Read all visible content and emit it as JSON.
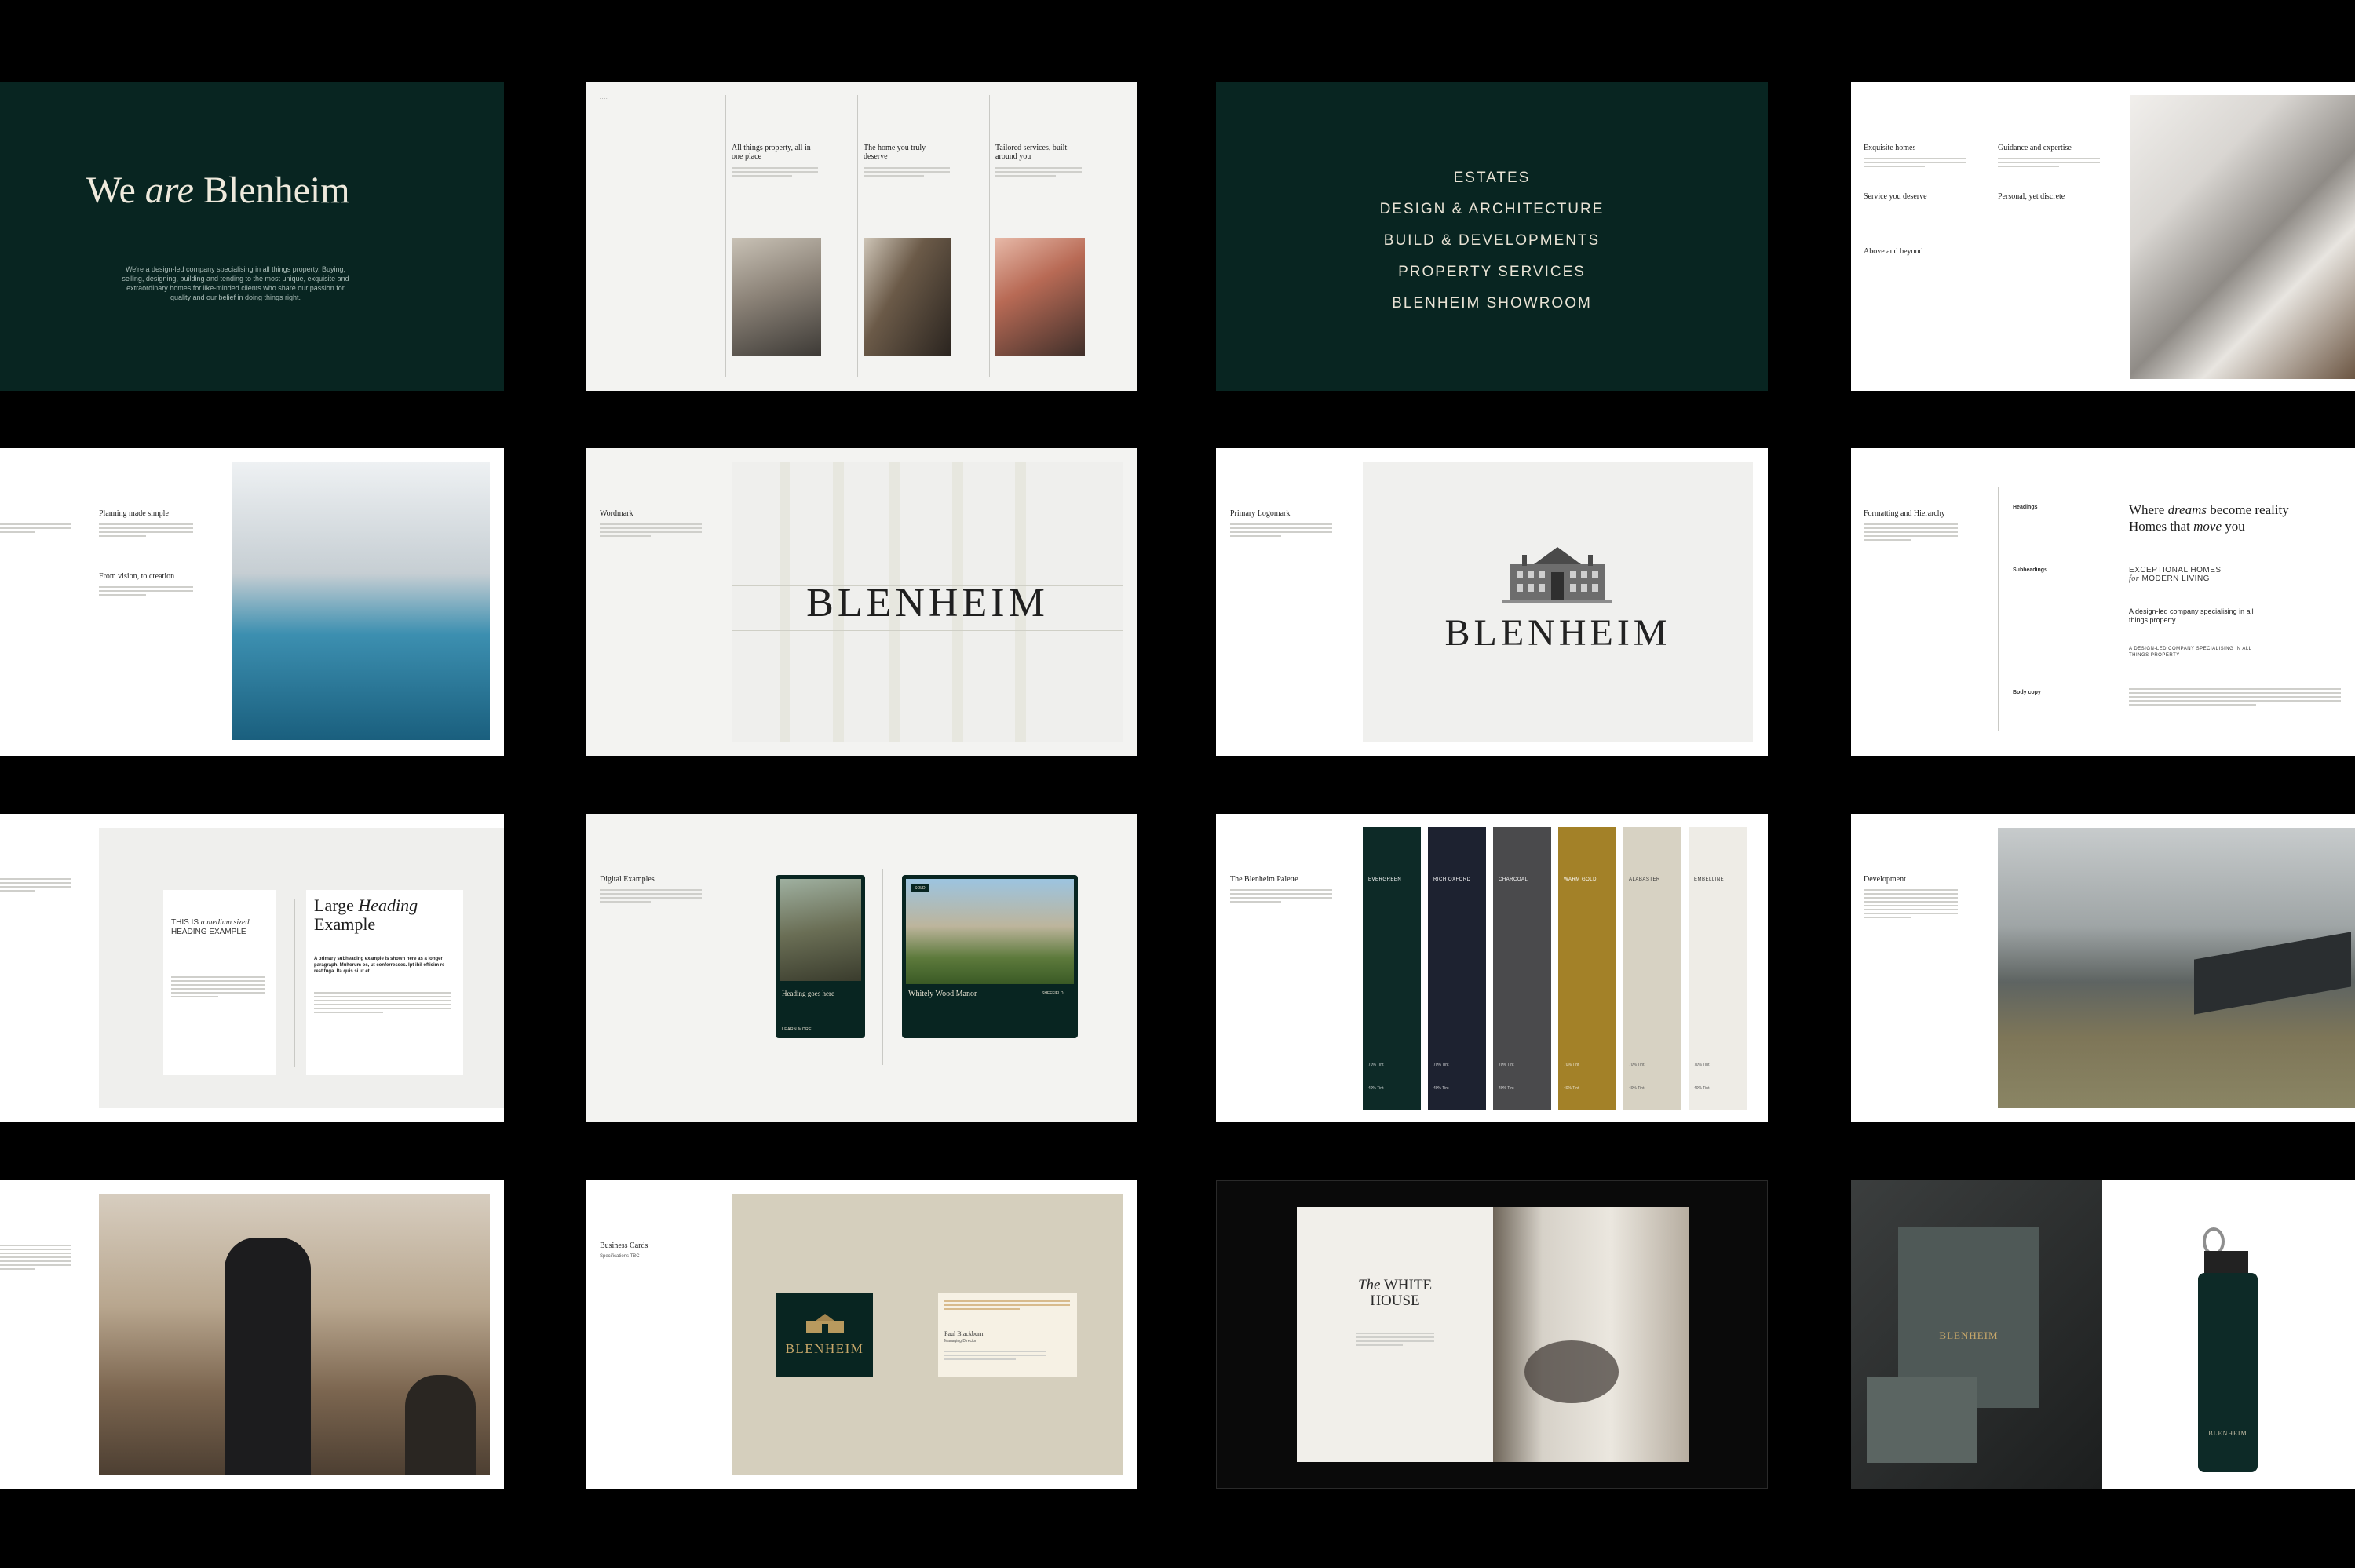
{
  "slide1": {
    "title_pre": "We ",
    "title_em": "are",
    "title_post": " Blenheim",
    "intro": "We're a design-led company specialising in all things property. Buying, selling, designing, building and tending to the most unique, exquisite and extraordinary homes for like-minded clients who share our passion for quality and our belief in doing things right."
  },
  "slide2": {
    "col1_heading": "All things property, all in one place",
    "col2_heading": "The home you truly deserve",
    "col3_heading": "Tailored services, built around you"
  },
  "slide3": {
    "services": [
      "ESTATES",
      "DESIGN & ARCHITECTURE",
      "BUILD & DEVELOPMENTS",
      "PROPERTY SERVICES",
      "BLENHEIM SHOWROOM"
    ]
  },
  "slide4": {
    "headings": [
      "Exquisite homes",
      "Service you deserve",
      "Above and beyond",
      "Guidance and expertise",
      "Personal, yet discrete"
    ]
  },
  "slide5": {
    "headings": [
      "Planning made simple",
      "From vision, to creation"
    ]
  },
  "slide6": {
    "label": "Wordmark",
    "wordmark": "BLENHEIM"
  },
  "slide7": {
    "label": "Primary Logomark",
    "wordmark": "BLENHEIM"
  },
  "slide8": {
    "label": "Formatting and Hierarchy",
    "spec_headings": "Headings",
    "spec_subheadings": "Subheadings",
    "spec_body": "Body copy",
    "ex_heading_1": "Where ",
    "ex_heading_em1": "dreams",
    "ex_heading_2": " become reality",
    "ex_heading_3": "Homes that ",
    "ex_heading_em2": "move",
    "ex_heading_4": " you",
    "ex_sub_1": "EXCEPTIONAL HOMES",
    "ex_sub_em": "for",
    "ex_sub_2": " MODERN LIVING",
    "ex_sub_3": "A design-led company specialising in all things property",
    "ex_sub_4": "A DESIGN-LED COMPANY SPECIALISING IN ALL THINGS PROPERTY"
  },
  "slide9": {
    "card1_line1": "THIS IS ",
    "card1_em": "a medium sized",
    "card1_line2": "HEADING EXAMPLE",
    "card2_line1": "Large ",
    "card2_em": "Heading",
    "card2_line2": "Example",
    "card2_sub": "A primary subheading example is shown here as a longer paragraph. Multorum os, ut conferresses. Ipt ihil officim re rest fuga. Ita quis si ut et."
  },
  "slide10": {
    "label": "Digital Examples",
    "phone_heading": "Heading goes here",
    "phone_btn": "LEARN MORE",
    "card_property": "Whitely Wood Manor",
    "card_tag": "SOLD",
    "card_location": "SHEFFIELD"
  },
  "slide11": {
    "label": "The Blenheim Palette",
    "swatches": [
      {
        "name": "EVERGREEN",
        "color": "#0d2a27"
      },
      {
        "name": "RICH OXFORD",
        "color": "#1d2230"
      },
      {
        "name": "CHARCOAL",
        "color": "#4a4a4c"
      },
      {
        "name": "WARM GOLD",
        "color": "#a38128"
      },
      {
        "name": "ALABASTER",
        "color": "#d7d2c3"
      },
      {
        "name": "EMBELLINE",
        "color": "#eeece6"
      }
    ],
    "tint_70": "70% Tint",
    "tint_40": "40% Tint"
  },
  "slide12": {
    "label": "Development"
  },
  "slide14": {
    "label": "Business Cards",
    "sub": "Specifications TBC",
    "logo": "BLENHEIM",
    "name": "Paul Blackburn",
    "role": "Managing Director"
  },
  "slide15": {
    "title_em": "The",
    "title_1": "WHITE",
    "title_2": "HOUSE"
  },
  "slide16": {
    "bag_logo": "BLENHEIM",
    "bottle_logo": "BLENHEIM"
  }
}
